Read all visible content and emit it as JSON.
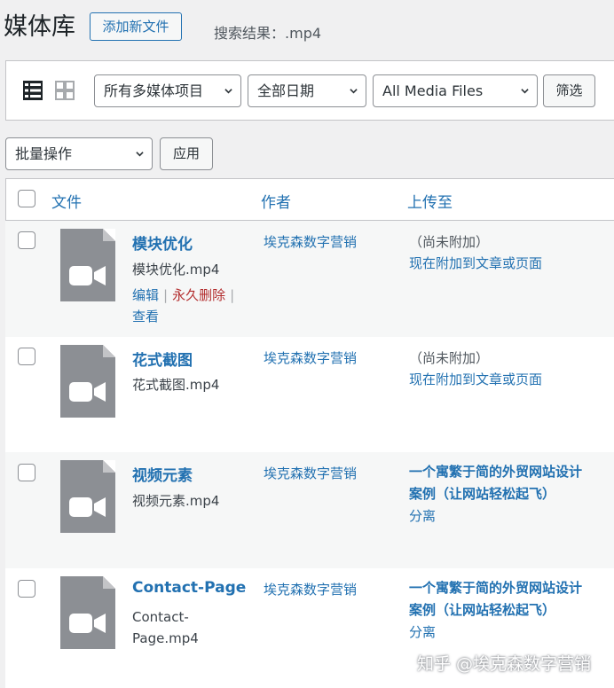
{
  "header": {
    "title": "媒体库",
    "add_new": "添加新文件",
    "search_label": "搜索结果：",
    "search_term": ".mp4"
  },
  "toolbar": {
    "view_icons": [
      "list-view-icon",
      "grid-view-icon"
    ],
    "type_filter": "所有多媒体项目",
    "date_filter": "全部日期",
    "media_filter": "All Media Files",
    "filter_button": "筛选"
  },
  "bulk": {
    "select": "批量操作",
    "apply": "应用"
  },
  "table": {
    "columns": [
      "文件",
      "作者",
      "上传至"
    ],
    "rows": [
      {
        "title": "模块优化",
        "filename": "模块优化.mp4",
        "author": "埃克森数字营销",
        "status": "（尚未附加）",
        "attach": "现在附加到文章或页面",
        "actions": {
          "edit": "编辑",
          "delete": "永久删除",
          "view": "查看"
        }
      },
      {
        "title": "花式截图",
        "filename": "花式截图.mp4",
        "author": "埃克森数字营销",
        "status": "（尚未附加）",
        "attach": "现在附加到文章或页面"
      },
      {
        "title": "视频元素",
        "filename": "视频元素.mp4",
        "author": "埃克森数字营销",
        "parent_line1": "一个寓繁于简的外贸网站设计",
        "parent_line2": "案例（让网站轻松起飞）",
        "detach": "分离"
      },
      {
        "title": "Contact-Page",
        "filename_line1": "Contact-",
        "filename_line2": "Page.mp4",
        "author": "埃克森数字营销",
        "parent_line1": "一个寓繁于简的外贸网站设计",
        "parent_line2": "案例（让网站轻松起飞）",
        "detach": "分离"
      }
    ]
  },
  "watermark": "知乎 @埃克森数字营销",
  "colors": {
    "link": "#2271b1",
    "delete": "#b32d2e",
    "thumb": "#8c8f94",
    "background": "#f0f0f1"
  }
}
